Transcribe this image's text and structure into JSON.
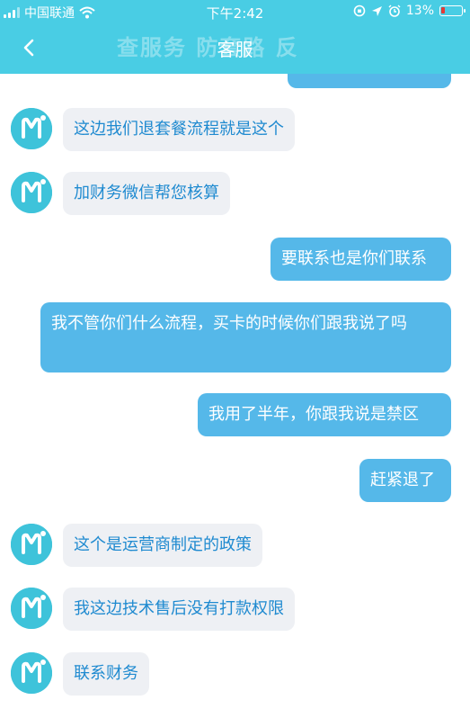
{
  "status_bar": {
    "carrier": "中国联通",
    "time": "下午2:42",
    "battery": "13%"
  },
  "nav": {
    "title": "客服",
    "back_icon": "chevron-left-icon"
  },
  "watermark": "查服务 防套路 反",
  "messages": [
    {
      "from": "agent",
      "text": "这边我们退套餐流程就是这个"
    },
    {
      "from": "agent",
      "text": "加财务微信帮您核算"
    },
    {
      "from": "user",
      "text": "要联系也是你们联系"
    },
    {
      "from": "user",
      "text": "我不管你们什么流程，买卡的时候你们跟我说了吗"
    },
    {
      "from": "user",
      "text": "我用了半年，你跟我说是禁区"
    },
    {
      "from": "user",
      "text": "赶紧退了"
    },
    {
      "from": "agent",
      "text": "这个是运营商制定的政策"
    },
    {
      "from": "agent",
      "text": "我这边技术售后没有打款权限"
    },
    {
      "from": "agent",
      "text": "联系财务"
    }
  ],
  "colors": {
    "header": "#49cde4",
    "user_bubble": "#55b8e9",
    "agent_bubble": "#eef0f4",
    "agent_text": "#1f8ad0"
  }
}
